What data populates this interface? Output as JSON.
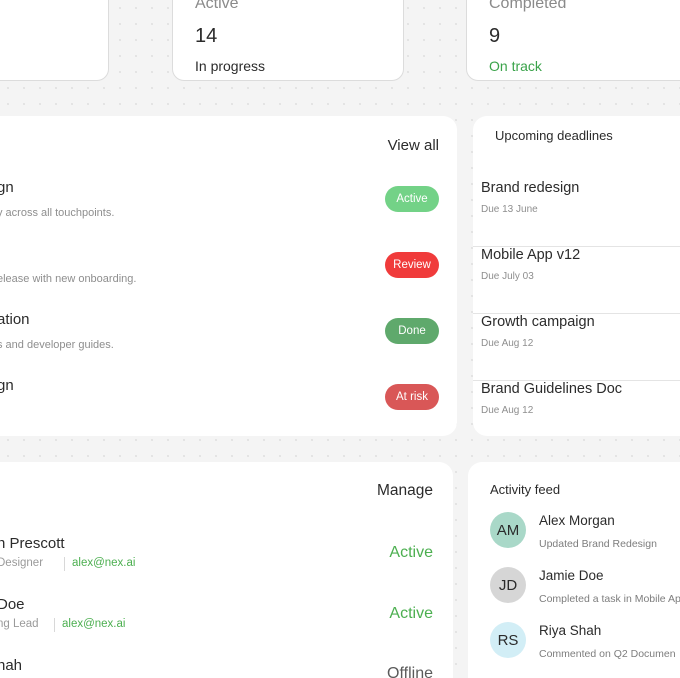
{
  "stats": [
    {
      "label": "",
      "value": "",
      "sub": ""
    },
    {
      "label": "Active",
      "value": "14",
      "sub": "In progress"
    },
    {
      "label": "Completed",
      "value": "9",
      "sub": "On track"
    }
  ],
  "projects": {
    "view_all_label": "View all",
    "items": [
      {
        "title": "gn",
        "desc": "y across all touchpoints.",
        "status": "Active",
        "color": "#73d287"
      },
      {
        "title": "",
        "desc": "elease with new onboarding.",
        "status": "Review",
        "color": "#f03b3b"
      },
      {
        "title": "ation",
        "desc": "s and developer guides.",
        "status": "Done",
        "color": "#5fa96c"
      },
      {
        "title": "gn",
        "desc": "",
        "status": "At risk",
        "color": "#d95757"
      }
    ]
  },
  "deadlines": {
    "title": "Upcoming deadlines",
    "items": [
      {
        "name": "Brand redesign",
        "date": "Due 13 June"
      },
      {
        "name": "Mobile App v12",
        "date": "Due July 03"
      },
      {
        "name": "Growth campaign",
        "date": "Due Aug 12"
      },
      {
        "name": "Brand Guidelines Doc",
        "date": "Due Aug 12"
      }
    ]
  },
  "team": {
    "manage_label": "Manage",
    "members": [
      {
        "name": "n Prescott",
        "role": "Designer",
        "email": "alex@nex.ai",
        "status": "Active",
        "status_color": "#4caf50"
      },
      {
        "name": "Doe",
        "role": "ng Lead",
        "email": "alex@nex.ai",
        "status": "Active",
        "status_color": "#4caf50"
      },
      {
        "name": "hah",
        "role": "",
        "email": "",
        "status": "Offline",
        "status_color": "#5a5a5a"
      }
    ]
  },
  "activity": {
    "title": "Activity feed",
    "items": [
      {
        "initials": "AM",
        "name": "Alex Morgan",
        "text": "Updated Brand Redesign",
        "avatar_color": "#a9d8c8"
      },
      {
        "initials": "JD",
        "name": "Jamie Doe",
        "text": "Completed a task in Mobile Ap",
        "avatar_color": "#d6d6d6"
      },
      {
        "initials": "RS",
        "name": "Riya Shah",
        "text": "Commented on Q2 Documen",
        "avatar_color": "#d2eef6"
      }
    ]
  }
}
